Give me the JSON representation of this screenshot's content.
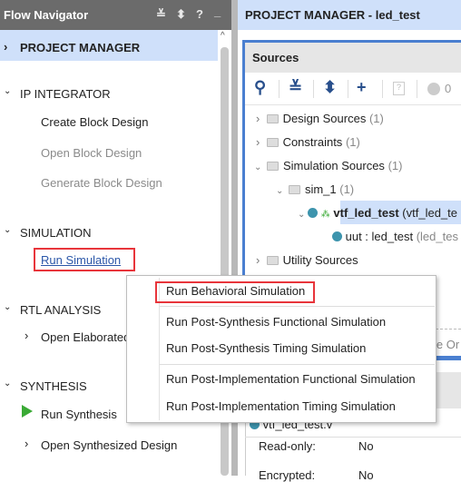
{
  "flow_navigator": {
    "title": "Flow Navigator",
    "header_icons": [
      "collapse-all-icon",
      "expand-all-icon",
      "help-icon",
      "minimize-icon"
    ],
    "header_glyphs": [
      "≚",
      "⬍",
      "?",
      "_"
    ],
    "sections": [
      {
        "label": "PROJECT MANAGER",
        "expanded": false,
        "selected": true
      },
      {
        "label": "IP INTEGRATOR",
        "expanded": true,
        "items": [
          "Create Block Design",
          "Open Block Design",
          "Generate Block Design"
        ]
      },
      {
        "label": "SIMULATION",
        "expanded": true,
        "items": [
          "Run Simulation"
        ]
      },
      {
        "label": "RTL ANALYSIS",
        "expanded": true,
        "items": [
          "Open Elaborated Design"
        ]
      },
      {
        "label": "SYNTHESIS",
        "expanded": true,
        "items": [
          "Run Synthesis",
          "Open Synthesized Design"
        ]
      }
    ]
  },
  "main": {
    "title": "PROJECT MANAGER - led_test",
    "sources": {
      "title": "Sources",
      "toolbar": [
        "search-icon",
        "collapse-all-icon",
        "expand-all-icon",
        "add-icon",
        "unknown-file-icon",
        "error-count-icon"
      ],
      "error_count": "0",
      "tree": [
        {
          "label": "Design Sources",
          "count": "(1)"
        },
        {
          "label": "Constraints",
          "count": "(1)"
        },
        {
          "label": "Simulation Sources",
          "count": "(1)"
        },
        {
          "label": "sim_1",
          "count": "(1)"
        },
        {
          "label": "vtf_led_test",
          "detail": "(vtf_led_te"
        },
        {
          "label": "uut : led_test",
          "detail": "(led_tes"
        },
        {
          "label": "Utility Sources",
          "count": ""
        }
      ],
      "hidden_tab_fragment": "le Or"
    },
    "properties": {
      "file": "vtf_led_test.v",
      "rows": [
        {
          "label": "Read-only:",
          "value": "No"
        },
        {
          "label": "Encrypted:",
          "value": "No"
        }
      ]
    }
  },
  "context_menu": {
    "items": [
      "Run Behavioral Simulation",
      "Run Post-Synthesis Functional Simulation",
      "Run Post-Synthesis Timing Simulation",
      "Run Post-Implementation Functional Simulation",
      "Run Post-Implementation Timing Simulation"
    ],
    "highlighted": "Run Behavioral Simulation"
  },
  "colors": {
    "highlight_box": "#e8353b",
    "accent_blue": "#4a7fd0",
    "selection": "#cfe0fa",
    "run_green": "#3aaa35"
  }
}
